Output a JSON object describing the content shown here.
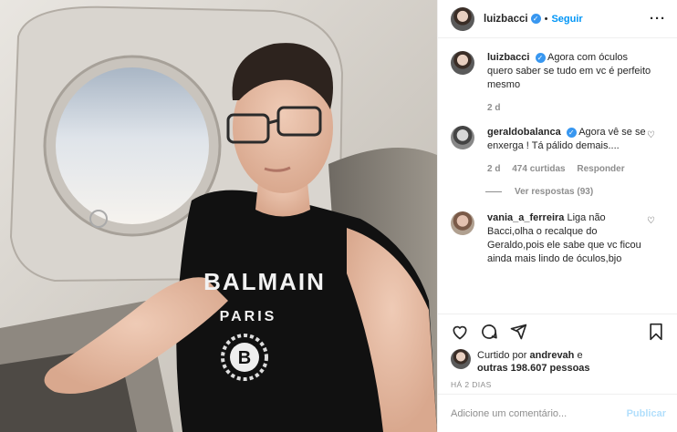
{
  "header": {
    "username": "luizbacci",
    "separator": "•",
    "follow_label": "Seguir",
    "more_label": "···"
  },
  "comments": [
    {
      "username": "luizbacci",
      "text": "Agora com óculos quero saber se tudo em vc é perfeito mesmo",
      "time": "2 d",
      "verified": true,
      "has_heart": false
    },
    {
      "username": "geraldobalanca",
      "text": "Agora vê se se enxerga ! Tá pálido demais....",
      "time": "2 d",
      "likes": "474 curtidas",
      "reply": "Responder",
      "verified": true,
      "has_heart": true
    },
    {
      "username": "vania_a_ferreira",
      "text": "Liga não Bacci,olha o recalque do Geraldo,pois ele sabe que vc ficou ainda mais lindo de óculos,bjo",
      "verified": false,
      "has_heart": true
    }
  ],
  "replies_label": "Ver respostas (93)",
  "likes": {
    "prefix": "Curtido por",
    "user": "andrevah",
    "connector": "e",
    "others": "outras 198.607 pessoas"
  },
  "timestamp": "HÁ 2 DIAS",
  "add_comment": {
    "placeholder": "Adicione um comentário...",
    "publish_label": "Publicar"
  },
  "photo": {
    "shirt_text_1": "BALMAIN",
    "shirt_text_2": "PARIS",
    "shirt_logo": "B"
  },
  "colors": {
    "accent": "#0095f6",
    "verified": "#3897f0",
    "muted": "#8e8e8e",
    "publish_disabled": "#b2dffc"
  }
}
